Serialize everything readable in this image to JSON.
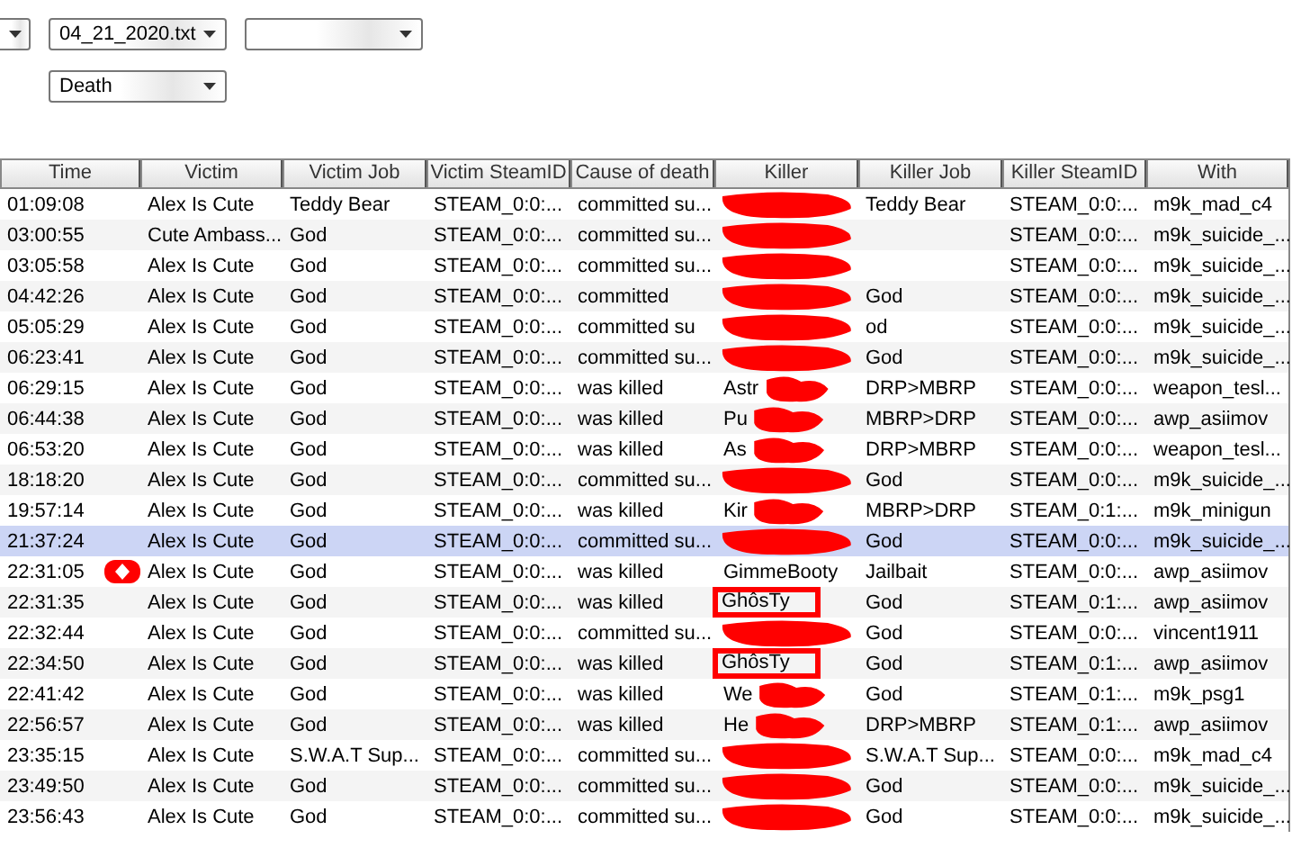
{
  "filters": [
    {
      "kind": "partial"
    },
    {
      "kind": "full",
      "value": "04_21_2020.txt"
    },
    {
      "kind": "full"
    }
  ],
  "type_filter": {
    "value": "Death"
  },
  "table": {
    "columns": [
      "Time",
      "Victim",
      "Victim Job",
      "Victim SteamID",
      "Cause of death",
      "Killer",
      "Killer Job",
      "Killer SteamID",
      "With"
    ],
    "rows": [
      {
        "time": "01:09:08",
        "victim": "Alex Is Cute",
        "victim_job": "Teddy Bear",
        "victim_id": "STEAM_0:0:...",
        "cause": "committed su...",
        "redacted": true,
        "killer_job": "Teddy Bear",
        "killer_id": "STEAM_0:0:...",
        "with": "m9k_mad_c4",
        "selected": false,
        "marked": false
      },
      {
        "time": "03:00:55",
        "victim": "Cute Ambass...",
        "victim_job": "God",
        "victim_id": "STEAM_0:0:...",
        "cause": "committed su...",
        "redacted": true,
        "killer_id": "STEAM_0:0:...",
        "with": "m9k_suicide_...",
        "selected": false,
        "marked": false
      },
      {
        "time": "03:05:58",
        "victim": "Alex Is Cute",
        "victim_job": "God",
        "victim_id": "STEAM_0:0:...",
        "cause": "committed su...",
        "redacted": true,
        "killer_id": "STEAM_0:0:...",
        "with": "m9k_suicide_...",
        "selected": false,
        "marked": false
      },
      {
        "time": "04:42:26",
        "victim": "Alex Is Cute",
        "victim_job": "God",
        "victim_id": "STEAM_0:0:...",
        "cause": "committed",
        "redacted": true,
        "killer_job": "God",
        "killer_id": "STEAM_0:0:...",
        "with": "m9k_suicide_...",
        "selected": false,
        "marked": false
      },
      {
        "time": "05:05:29",
        "victim": "Alex Is Cute",
        "victim_job": "God",
        "victim_id": "STEAM_0:0:...",
        "cause": "committed su",
        "redacted": true,
        "killer_job": "od",
        "killer_id": "STEAM_0:0:...",
        "with": "m9k_suicide_...",
        "selected": false,
        "marked": false
      },
      {
        "time": "06:23:41",
        "victim": "Alex Is Cute",
        "victim_job": "God",
        "victim_id": "STEAM_0:0:...",
        "cause": "committed su...",
        "redacted": true,
        "killer_job": "God",
        "killer_id": "STEAM_0:0:...",
        "with": "m9k_suicide_...",
        "selected": false,
        "marked": false
      },
      {
        "time": "06:29:15",
        "victim": "Alex Is Cute",
        "victim_job": "God",
        "victim_id": "STEAM_0:0:...",
        "cause": "was killed",
        "killer": "Astr",
        "redacted": true,
        "killer_job": "DRP>MBRP",
        "killer_id": "STEAM_0:0:...",
        "with": "weapon_tesl...",
        "selected": false,
        "marked": false
      },
      {
        "time": "06:44:38",
        "victim": "Alex Is Cute",
        "victim_job": "God",
        "victim_id": "STEAM_0:0:...",
        "cause": "was killed",
        "killer": "Pu",
        "redacted": true,
        "killer_job": "MBRP>DRP",
        "killer_id": "STEAM_0:0:...",
        "with": "awp_asiimov",
        "selected": false,
        "marked": false
      },
      {
        "time": "06:53:20",
        "victim": "Alex Is Cute",
        "victim_job": "God",
        "victim_id": "STEAM_0:0:...",
        "cause": "was killed",
        "killer": "As",
        "redacted": true,
        "killer_job": "DRP>MBRP",
        "killer_id": "STEAM_0:0:...",
        "with": "weapon_tesl...",
        "selected": false,
        "marked": false
      },
      {
        "time": "18:18:20",
        "victim": "Alex Is Cute",
        "victim_job": "God",
        "victim_id": "STEAM_0:0:...",
        "cause": "committed su...",
        "redacted": true,
        "killer_job": "God",
        "killer_id": "STEAM_0:0:...",
        "with": "m9k_suicide_...",
        "selected": false,
        "marked": false
      },
      {
        "time": "19:57:14",
        "victim": "Alex Is Cute",
        "victim_job": "God",
        "victim_id": "STEAM_0:0:...",
        "cause": "was killed",
        "killer": "Kir",
        "redacted": true,
        "killer_job": "MBRP>DRP",
        "killer_id": "STEAM_0:1:...",
        "with": "m9k_minigun",
        "selected": false,
        "marked": false
      },
      {
        "time": "21:37:24",
        "victim": "Alex Is Cute",
        "victim_job": "God",
        "victim_id": "STEAM_0:0:...",
        "cause": "committed su...",
        "redacted": true,
        "killer_job": "God",
        "killer_id": "STEAM_0:0:...",
        "with": "m9k_suicide_...",
        "selected": true,
        "marked": false
      },
      {
        "time": "22:31:05",
        "victim": "Alex Is Cute",
        "victim_job": "God",
        "victim_id": "STEAM_0:0:...",
        "cause": "was killed",
        "killer": "GimmeBooty",
        "redacted": false,
        "killer_job": "Jailbait",
        "killer_id": "STEAM_0:0:...",
        "with": "awp_asiimov",
        "selected": false,
        "marked": true
      },
      {
        "time": "22:31:35",
        "victim": "Alex Is Cute",
        "victim_job": "God",
        "victim_id": "STEAM_0:0:...",
        "cause": "was killed",
        "killer": "GhôsTy",
        "outlined": true,
        "redacted": false,
        "killer_job": "God",
        "killer_id": "STEAM_0:1:...",
        "with": "awp_asiimov",
        "selected": false,
        "marked": false
      },
      {
        "time": "22:32:44",
        "victim": "Alex Is Cute",
        "victim_job": "God",
        "victim_id": "STEAM_0:0:...",
        "cause": "committed su...",
        "redacted": true,
        "killer_job": "God",
        "killer_id": "STEAM_0:0:...",
        "with": "vincent1911",
        "selected": false,
        "marked": false
      },
      {
        "time": "22:34:50",
        "victim": "Alex Is Cute",
        "victim_job": "God",
        "victim_id": "STEAM_0:0:...",
        "cause": "was killed",
        "killer": "GhôsTy",
        "outlined": true,
        "redacted": false,
        "killer_job": "God",
        "killer_id": "STEAM_0:1:...",
        "with": "awp_asiimov",
        "selected": false,
        "marked": false
      },
      {
        "time": "22:41:42",
        "victim": "Alex Is Cute",
        "victim_job": "God",
        "victim_id": "STEAM_0:0:...",
        "cause": "was killed",
        "killer": "We",
        "redacted": true,
        "killer_job": "God",
        "killer_id": "STEAM_0:1:...",
        "with": "m9k_psg1",
        "selected": false,
        "marked": false
      },
      {
        "time": "22:56:57",
        "victim": "Alex Is Cute",
        "victim_job": "God",
        "victim_id": "STEAM_0:0:...",
        "cause": "was killed",
        "killer": "He",
        "redacted": true,
        "killer_job": "DRP>MBRP",
        "killer_id": "STEAM_0:1:...",
        "with": "awp_asiimov",
        "selected": false,
        "marked": false
      },
      {
        "time": "23:35:15",
        "victim": "Alex Is Cute",
        "victim_job": "S.W.A.T Sup...",
        "victim_id": "STEAM_0:0:...",
        "cause": "committed su...",
        "redacted": true,
        "killer_job": "S.W.A.T Sup...",
        "killer_id": "STEAM_0:0:...",
        "with": "m9k_mad_c4",
        "selected": false,
        "marked": false
      },
      {
        "time": "23:49:50",
        "victim": "Alex Is Cute",
        "victim_job": "God",
        "victim_id": "STEAM_0:0:...",
        "cause": "committed su...",
        "redacted": true,
        "killer_job": "God",
        "killer_id": "STEAM_0:0:...",
        "with": "m9k_suicide_...",
        "selected": false,
        "marked": false
      },
      {
        "time": "23:56:43",
        "victim": "Alex Is Cute",
        "victim_job": "God",
        "victim_id": "STEAM_0:0:...",
        "cause": "committed su...",
        "redacted": true,
        "killer_job": "God",
        "killer_id": "STEAM_0:0:...",
        "with": "m9k_suicide_...",
        "selected": false,
        "marked": false
      }
    ]
  }
}
